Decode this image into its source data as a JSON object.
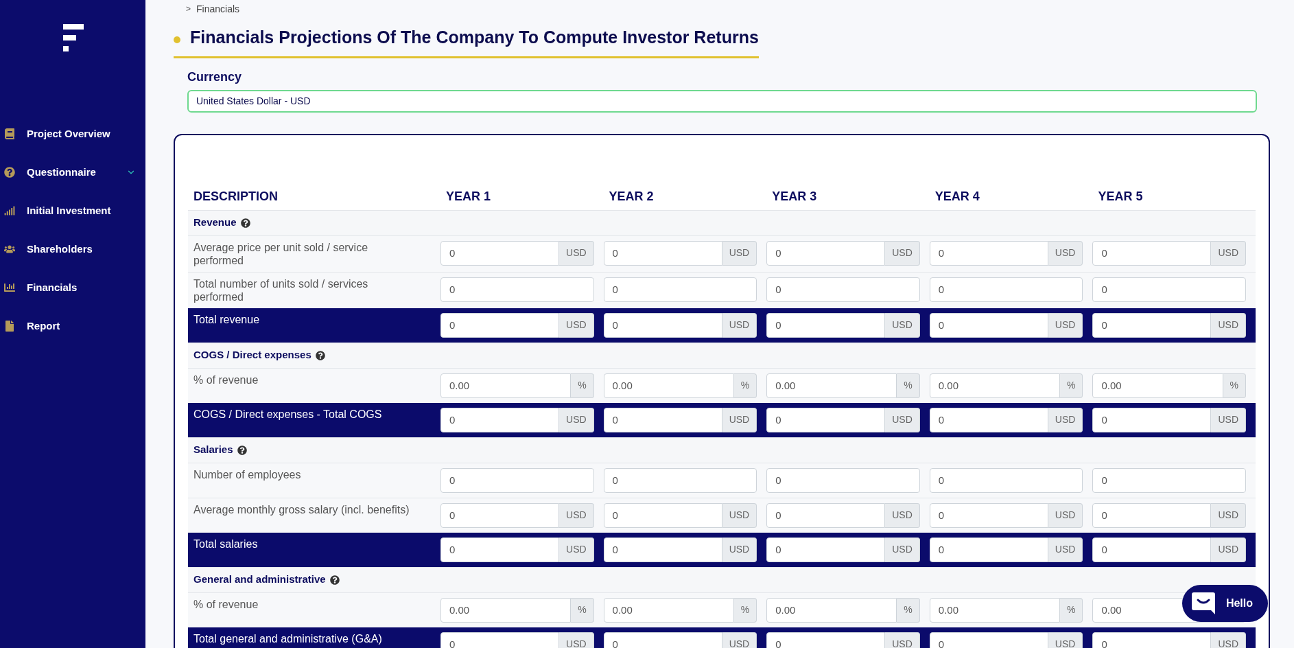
{
  "sidebar": {
    "items": [
      {
        "label": "Project Overview",
        "expandable": false
      },
      {
        "label": "Questionnaire",
        "expandable": true
      },
      {
        "label": "Initial Investment",
        "expandable": false
      },
      {
        "label": "Shareholders",
        "expandable": false
      },
      {
        "label": "Financials",
        "expandable": false
      },
      {
        "label": "Report",
        "expandable": false
      }
    ]
  },
  "breadcrumb": {
    "separator": ">",
    "label": "Financials"
  },
  "title": "Financials Projections Of The Company To Compute Investor Returns",
  "currency": {
    "label": "Currency",
    "value": "United States Dollar - USD"
  },
  "table": {
    "columns": [
      "DESCRIPTION",
      "YEAR 1",
      "YEAR 2",
      "YEAR 3",
      "YEAR 4",
      "YEAR 5"
    ],
    "rows": [
      {
        "kind": "section",
        "label": "Revenue"
      },
      {
        "kind": "input",
        "label": "Average price per unit sold / service performed",
        "cells": [
          {
            "value": "0",
            "unit": "USD"
          },
          {
            "value": "0",
            "unit": "USD"
          },
          {
            "value": "0",
            "unit": "USD"
          },
          {
            "value": "0",
            "unit": "USD"
          },
          {
            "value": "0",
            "unit": "USD"
          }
        ]
      },
      {
        "kind": "input",
        "label": "Total number of units sold / services performed",
        "cells": [
          {
            "value": "0"
          },
          {
            "value": "0"
          },
          {
            "value": "0"
          },
          {
            "value": "0"
          },
          {
            "value": "0"
          }
        ]
      },
      {
        "kind": "total",
        "label": "Total revenue",
        "cells": [
          {
            "value": "0",
            "unit": "USD"
          },
          {
            "value": "0",
            "unit": "USD"
          },
          {
            "value": "0",
            "unit": "USD"
          },
          {
            "value": "0",
            "unit": "USD"
          },
          {
            "value": "0",
            "unit": "USD"
          }
        ]
      },
      {
        "kind": "section",
        "label": "COGS / Direct expenses"
      },
      {
        "kind": "input",
        "label": "% of revenue",
        "cells": [
          {
            "value": "0.00",
            "unit": "%"
          },
          {
            "value": "0.00",
            "unit": "%"
          },
          {
            "value": "0.00",
            "unit": "%"
          },
          {
            "value": "0.00",
            "unit": "%"
          },
          {
            "value": "0.00",
            "unit": "%"
          }
        ]
      },
      {
        "kind": "total",
        "label": "COGS / Direct expenses - Total COGS",
        "cells": [
          {
            "value": "0",
            "unit": "USD"
          },
          {
            "value": "0",
            "unit": "USD"
          },
          {
            "value": "0",
            "unit": "USD"
          },
          {
            "value": "0",
            "unit": "USD"
          },
          {
            "value": "0",
            "unit": "USD"
          }
        ]
      },
      {
        "kind": "section",
        "label": "Salaries"
      },
      {
        "kind": "input",
        "label": "Number of employees",
        "cells": [
          {
            "value": "0"
          },
          {
            "value": "0"
          },
          {
            "value": "0"
          },
          {
            "value": "0"
          },
          {
            "value": "0"
          }
        ]
      },
      {
        "kind": "input",
        "label": "Average monthly gross salary (incl. benefits)",
        "cells": [
          {
            "value": "0",
            "unit": "USD"
          },
          {
            "value": "0",
            "unit": "USD"
          },
          {
            "value": "0",
            "unit": "USD"
          },
          {
            "value": "0",
            "unit": "USD"
          },
          {
            "value": "0",
            "unit": "USD"
          }
        ]
      },
      {
        "kind": "total",
        "label": "Total salaries",
        "cells": [
          {
            "value": "0",
            "unit": "USD"
          },
          {
            "value": "0",
            "unit": "USD"
          },
          {
            "value": "0",
            "unit": "USD"
          },
          {
            "value": "0",
            "unit": "USD"
          },
          {
            "value": "0",
            "unit": "USD"
          }
        ]
      },
      {
        "kind": "section",
        "label": "General and administrative"
      },
      {
        "kind": "input",
        "label": "% of revenue",
        "cells": [
          {
            "value": "0.00",
            "unit": "%"
          },
          {
            "value": "0.00",
            "unit": "%"
          },
          {
            "value": "0.00",
            "unit": "%"
          },
          {
            "value": "0.00",
            "unit": "%"
          },
          {
            "value": "0.00"
          }
        ]
      },
      {
        "kind": "total",
        "label": "Total general and administrative (G&A)",
        "cells": [
          {
            "value": "0",
            "unit": "USD"
          },
          {
            "value": "0",
            "unit": "USD"
          },
          {
            "value": "0",
            "unit": "USD"
          },
          {
            "value": "0",
            "unit": "USD"
          },
          {
            "value": "0",
            "unit": "USD"
          }
        ]
      }
    ]
  },
  "chat": {
    "label": "Hello"
  }
}
